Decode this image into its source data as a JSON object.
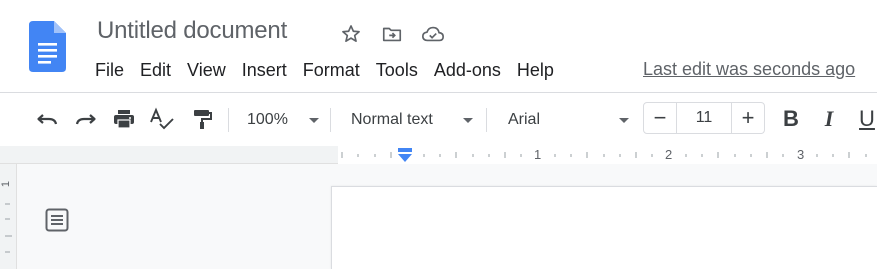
{
  "app": {
    "title": "Untitled document",
    "logo_icon": "google-docs-logo",
    "title_icons": [
      "star-icon",
      "move-to-folder-icon",
      "cloud-saved-icon"
    ]
  },
  "menu": {
    "items": [
      "File",
      "Edit",
      "View",
      "Insert",
      "Format",
      "Tools",
      "Add-ons",
      "Help"
    ],
    "last_edit": "Last edit was seconds ago"
  },
  "toolbar": {
    "buttons": [
      "undo-icon",
      "redo-icon",
      "print-icon",
      "spellcheck-icon",
      "paint-format-icon"
    ],
    "zoom": "100%",
    "style": "Normal text",
    "font": "Arial",
    "font_size": "11",
    "decrease_label": "−",
    "increase_label": "+",
    "bold": "B",
    "italic": "I",
    "underline": "U"
  },
  "ruler": {
    "labels": [
      "1",
      "2",
      "3"
    ],
    "vertical_label": "1"
  },
  "colors": {
    "doc_blue": "#4285f4",
    "indent_marker": "#4285f4",
    "text": "#3c4043",
    "muted": "#5f6368"
  },
  "sidebar": {
    "outline_icon": "document-outline-icon"
  }
}
